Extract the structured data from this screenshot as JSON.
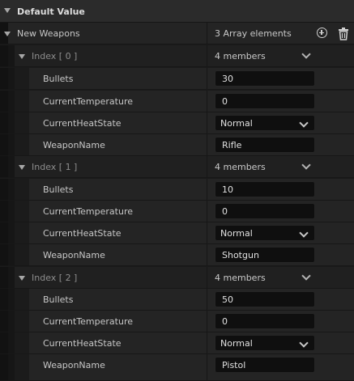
{
  "section": {
    "title": "Default Value"
  },
  "array": {
    "name": "New Weapons",
    "summary": "3 Array elements"
  },
  "elements": [
    {
      "index_label": "Index [ 0 ]",
      "members": "4 members",
      "fields": {
        "bullets_label": "Bullets",
        "bullets_value": "30",
        "temp_label": "CurrentTemperature",
        "temp_value": "0",
        "heat_label": "CurrentHeatState",
        "heat_value": "Normal",
        "name_label": "WeaponName",
        "name_value": "Rifle"
      }
    },
    {
      "index_label": "Index [ 1 ]",
      "members": "4 members",
      "fields": {
        "bullets_label": "Bullets",
        "bullets_value": "10",
        "temp_label": "CurrentTemperature",
        "temp_value": "0",
        "heat_label": "CurrentHeatState",
        "heat_value": "Normal",
        "name_label": "WeaponName",
        "name_value": "Shotgun"
      }
    },
    {
      "index_label": "Index [ 2 ]",
      "members": "4 members",
      "fields": {
        "bullets_label": "Bullets",
        "bullets_value": "50",
        "temp_label": "CurrentTemperature",
        "temp_value": "0",
        "heat_label": "CurrentHeatState",
        "heat_value": "Normal",
        "name_label": "WeaponName",
        "name_value": "Pistol"
      }
    }
  ],
  "icons": {
    "section_toggle": "triangle-down-icon",
    "add": "plus-circle-icon",
    "delete": "trash-icon",
    "dropdown": "chevron-down-icon"
  }
}
